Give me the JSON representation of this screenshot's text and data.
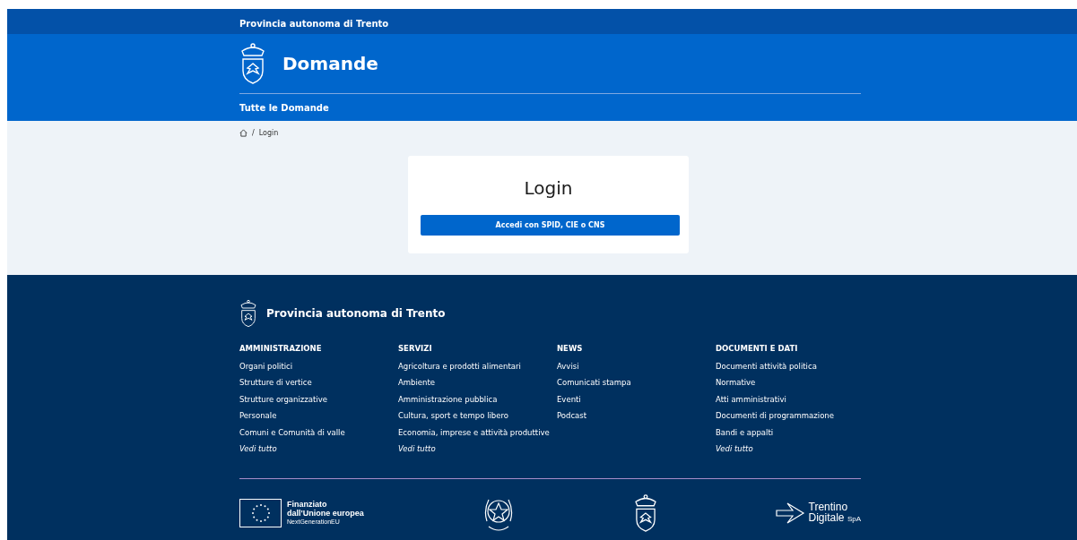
{
  "top_bar": {
    "title": "Provincia autonoma di Trento"
  },
  "header": {
    "title": "Domande",
    "nav": [
      {
        "label": "Tutte le Domande"
      }
    ]
  },
  "breadcrumb": {
    "separator": "/",
    "items": [
      {
        "label": "Login"
      }
    ]
  },
  "login": {
    "title": "Login",
    "button": "Accedi con SPID, CIE o CNS"
  },
  "footer": {
    "title": "Provincia autonoma di Trento",
    "columns": [
      {
        "heading": "AMMINISTRAZIONE",
        "links": [
          "Organi politici",
          "Strutture di vertice",
          "Strutture organizzative",
          "Personale",
          "Comuni e Comunità di valle"
        ],
        "more": "Vedi tutto"
      },
      {
        "heading": "SERVIZI",
        "links": [
          "Agricoltura e prodotti alimentari",
          "Ambiente",
          "Amministrazione pubblica",
          "Cultura, sport e tempo libero",
          "Economia, imprese e attività produttive"
        ],
        "more": "Vedi tutto"
      },
      {
        "heading": "NEWS",
        "links": [
          "Avvisi",
          "Comunicati stampa",
          "Eventi",
          "Podcast"
        ]
      },
      {
        "heading": "DOCUMENTI E DATI",
        "links": [
          "Documenti attività politica",
          "Normative",
          "Atti amministrativi",
          "Documenti di programmazione",
          "Bandi e appalti"
        ],
        "more": "Vedi tutto"
      }
    ],
    "eu": {
      "line1": "Finanziato",
      "line2": "dall'Unione europea",
      "line3": "NextGenerationEU"
    },
    "partner": {
      "name1": "Trentino",
      "name2": "Digitale",
      "suffix": "SpA"
    }
  }
}
